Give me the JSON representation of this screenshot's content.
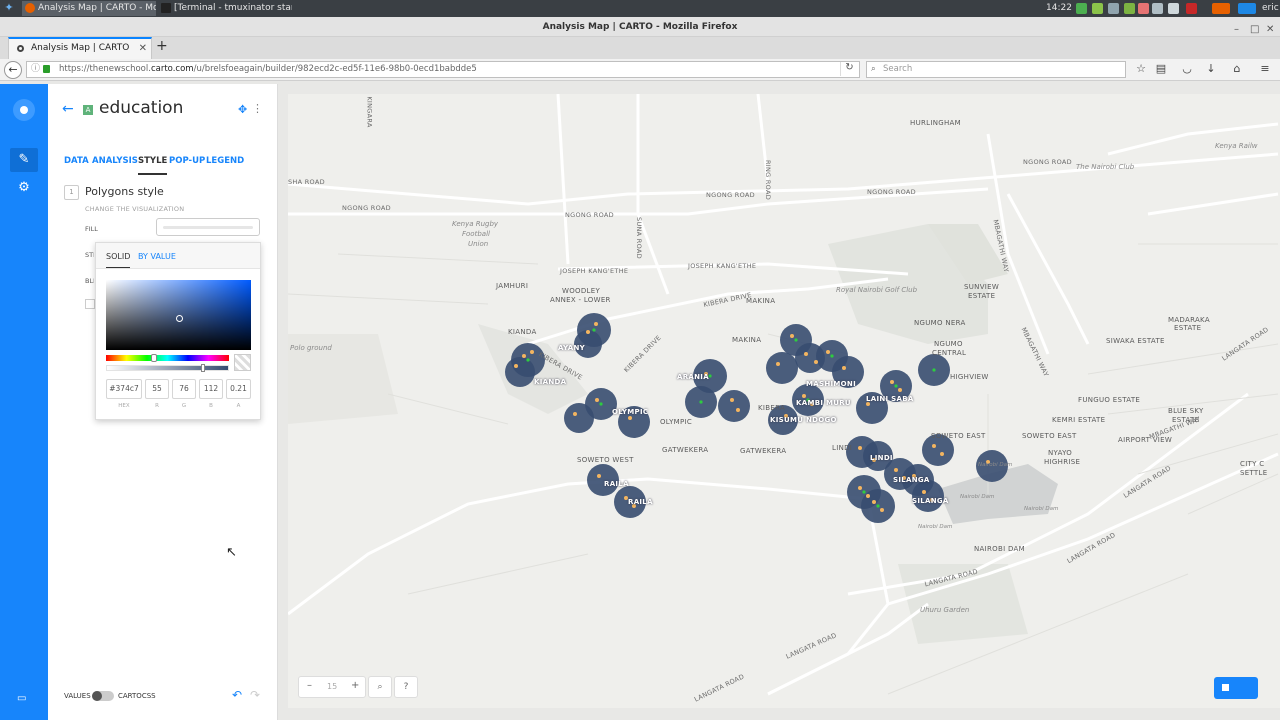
{
  "taskbar": {
    "tasks": [
      {
        "label": "Analysis Map | CARTO - Moz...",
        "active": true
      },
      {
        "label": "[Terminal - tmuxinator start ...",
        "active": false
      }
    ],
    "clock": "14:22",
    "user": "eric"
  },
  "browser": {
    "window_title": "Analysis Map | CARTO - Mozilla Firefox",
    "tab_title": "Analysis Map | CARTO",
    "url_prefix": "https://thenewschool.",
    "url_host": "carto.com",
    "url_path": "/u/brelsfoeagain/builder/982ecd2c-ed5f-11e6-98b0-0ecd1babdde5",
    "search_placeholder": "Search"
  },
  "panel": {
    "layer_badge": "A",
    "layer_title": "education",
    "tabs": [
      "DATA",
      "ANALYSIS",
      "STYLE",
      "POP-UP",
      "LEGEND"
    ],
    "active_tab": "STYLE",
    "section_number": "1",
    "section_title": "Polygons style",
    "section_subtitle": "CHANGE THE VISUALIZATION",
    "rows": [
      "FILL",
      "STROKE",
      "BLENDING"
    ],
    "bottom_values": "VALUES",
    "bottom_cartocss": "CARTOCSS"
  },
  "picker": {
    "tab_solid": "SOLID",
    "tab_by_value": "BY VALUE",
    "hex": "#374c7",
    "r": "55",
    "g": "76",
    "b": "112",
    "a": "0.21",
    "cap_hex": "HEX",
    "cap_r": "R",
    "cap_g": "G",
    "cap_b": "B",
    "cap_a": "A"
  },
  "map": {
    "zoom": "15",
    "accent": "#1785fb",
    "circle_color": "#374c70",
    "labels": {
      "kingara": "KINGARA",
      "hurlingham": "HURLINGHAM",
      "sha_road": "SHA ROAD",
      "ngong_road_1": "NGONG ROAD",
      "ngong_road_2": "NGONG ROAD",
      "ngong_road_3": "NGONG ROAD",
      "ngong_road_4": "NGONG ROAD",
      "ngong_road_5": "NGONG ROAD",
      "ring_road": "RING ROAD",
      "suna_road": "SUNA ROAD",
      "kenya_railw": "Kenya Railw",
      "nairobi_club": "The Nairobi Club",
      "kenya_rugby": "Kenya Rugby",
      "football": "Football",
      "union": "Union",
      "joseph_kangethe_1": "JOSEPH KANG'ETHE",
      "joseph_kangethe_2": "JOSEPH KANG'ETHE",
      "jamhuri": "JAMHURI",
      "woodley": "WOODLEY",
      "annex_lower": "ANNEX - LOWER",
      "kibera_drive_1": "KIBERA DRIVE",
      "kibera_drive_2": "KIBERA DRIVE",
      "kibera_drive_3": "KIBERA DRIVE",
      "makina_1": "MAKINA",
      "makina_2": "MAKINA",
      "royal_golf": "Royal Nairobi Golf Club",
      "sunview": "SUNVIEW",
      "estate_sunview": "ESTATE",
      "madaraka": "MADARAKA",
      "estate_madaraka": "ESTATE",
      "ngumo_nera": "NGUMO NERA",
      "ngumo": "NGUMO",
      "central": "CENTRAL",
      "highview": "HIGHVIEW",
      "siwaka": "SIWAKA ESTATE",
      "fungo": "FUNGUO ESTATE",
      "kemri": "KEMRI ESTATE",
      "blue_sky": "BLUE SKY",
      "estate_blue": "ESTATE",
      "soweto_east_r": "SOWETO EAST",
      "airport_view": "AIRPORT VIEW",
      "nyayo": "NYAYO",
      "highrise": "HIGHRISE",
      "city_c": "CITY C",
      "settle": "SETTLE",
      "kianda_1": "KIANDA",
      "kianda_2": "KIANDA",
      "ayany": "AYANY",
      "polo": "Polo ground",
      "olympic_1": "OLYMPIC",
      "olympic_2": "OLYMPIC",
      "arania": "ARANIA",
      "mashimoni": "MASHIMONI",
      "laini_saba": "LAINI SABA",
      "kibera": "KIBERA",
      "kambi_muru": "KAMBI MURU",
      "kisumu_ndogo": "KISUMU NDOGO",
      "soweto_east": "SOWETO EAST",
      "soweto_west": "SOWETO WEST",
      "gatwekera_1": "GATWEKERA",
      "gatwekera_2": "GATWEKERA",
      "lindi_1": "LINDI",
      "lindi_2": "LINDI",
      "silanga_1": "SILANGA",
      "silanga_2": "SILANGA",
      "raila_1": "RAILA",
      "raila_2": "RAILA",
      "nairobi_dam": "NAIROBI DAM",
      "nairobi_dam_w1": "Nairobi Dam",
      "nairobi_dam_w2": "Nairobi Dam",
      "nairobi_dam_w3": "Nairobi Dam",
      "nairobi_dam_w4": "Nairobi Dam",
      "langata_1": "LANGATA ROAD",
      "langata_2": "LANGATA ROAD",
      "langata_3": "LANGATA ROAD",
      "langata_4": "LANGATA ROAD",
      "langata_5": "LANGATA ROAD",
      "langata_6": "LANGATA ROAD",
      "uhuru": "Uhuru Garden",
      "mbagathi": "MBAGATHI WAY",
      "mbagathi_2": "MBAGATHI WAY",
      "mbagathi_3": "MBAGATHI WAY"
    }
  }
}
